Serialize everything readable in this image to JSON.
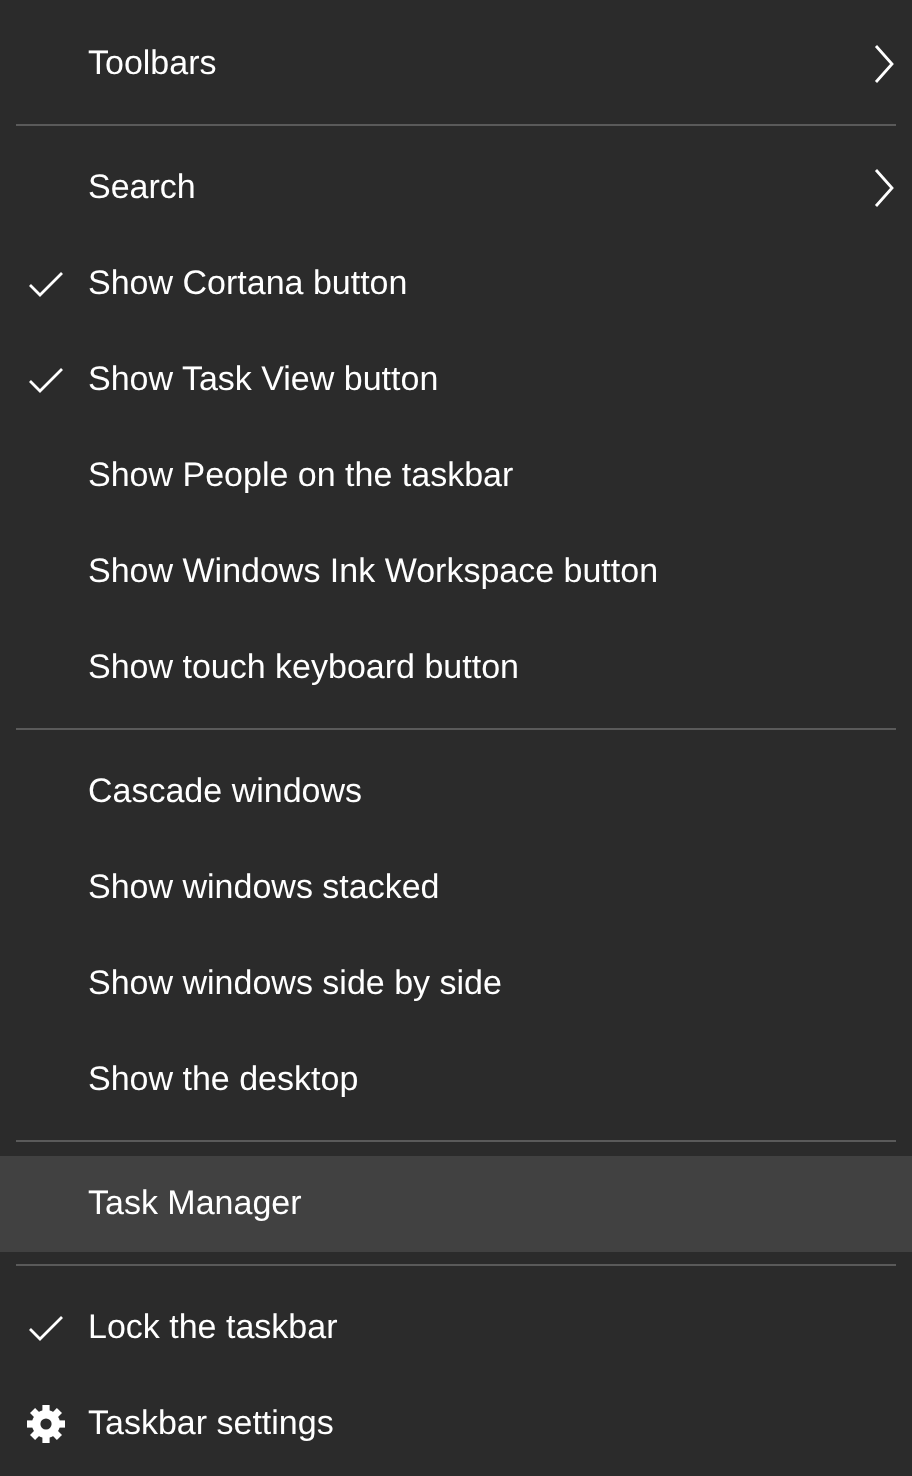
{
  "menu": {
    "groups": [
      [
        {
          "label": "Toolbars",
          "kind": "submenu",
          "selected": false
        }
      ],
      [
        {
          "label": "Search",
          "kind": "submenu",
          "selected": false
        },
        {
          "label": "Show Cortana button",
          "kind": "toggle",
          "checked": true,
          "selected": false
        },
        {
          "label": "Show Task View button",
          "kind": "toggle",
          "checked": true,
          "selected": false
        },
        {
          "label": "Show People on the taskbar",
          "kind": "toggle",
          "checked": false,
          "selected": false
        },
        {
          "label": "Show Windows Ink Workspace button",
          "kind": "toggle",
          "checked": false,
          "selected": false
        },
        {
          "label": "Show touch keyboard button",
          "kind": "toggle",
          "checked": false,
          "selected": false
        }
      ],
      [
        {
          "label": "Cascade windows",
          "kind": "command",
          "selected": false
        },
        {
          "label": "Show windows stacked",
          "kind": "command",
          "selected": false
        },
        {
          "label": "Show windows side by side",
          "kind": "command",
          "selected": false
        },
        {
          "label": "Show the desktop",
          "kind": "command",
          "selected": false
        }
      ],
      [
        {
          "label": "Task Manager",
          "kind": "command",
          "selected": true
        }
      ],
      [
        {
          "label": "Lock the taskbar",
          "kind": "toggle",
          "checked": true,
          "selected": false
        },
        {
          "label": "Taskbar settings",
          "kind": "settings",
          "selected": false
        }
      ]
    ]
  }
}
